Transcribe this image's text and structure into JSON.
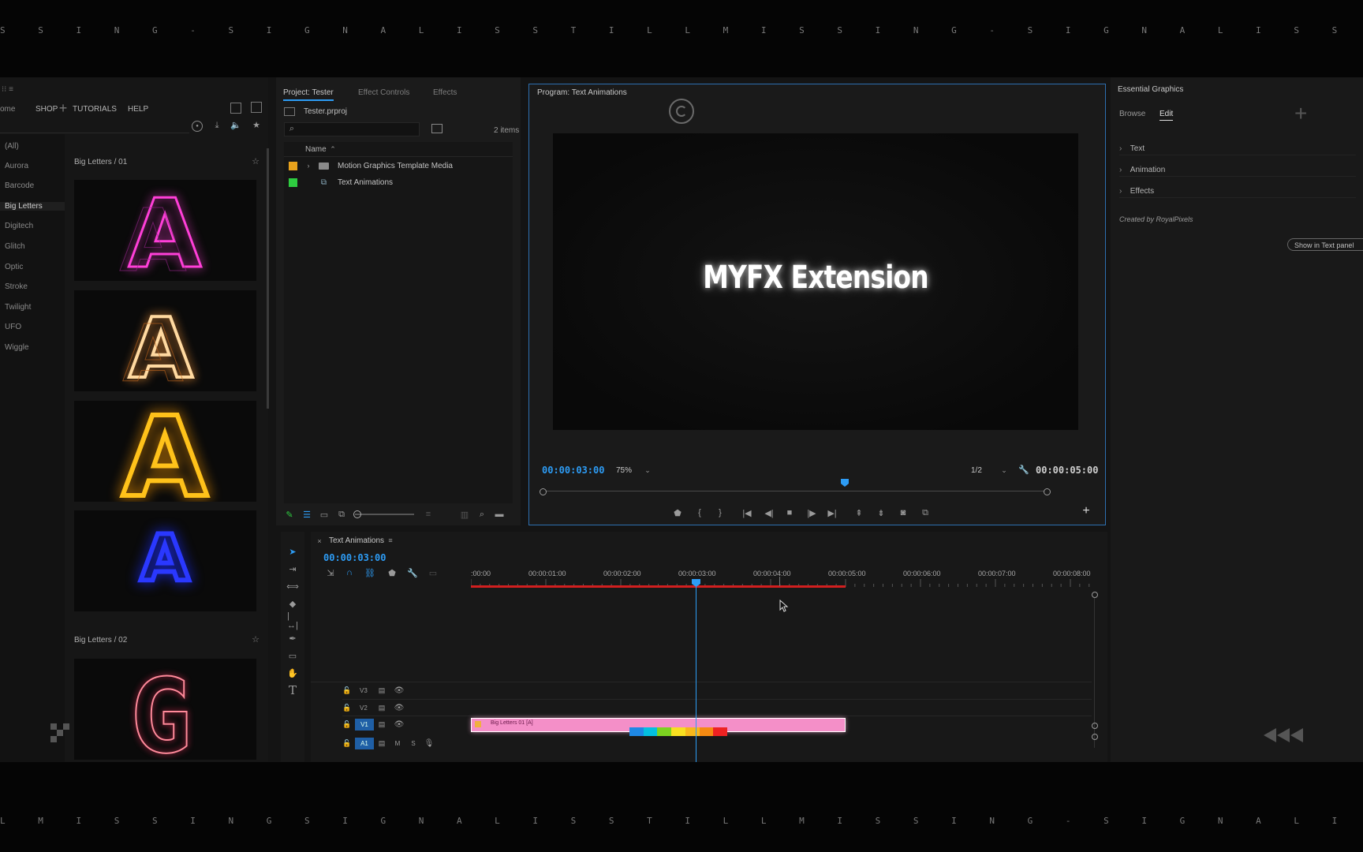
{
  "ticker": {
    "top": "S S I N G - S I G N A L I S S T I L L M I S S I N G - S I G N A L I S S T I L L M I S S I N G - S I G N A L I S S T I L L M I S S I N G S I G N A L I S",
    "bottom": "L M I S S I N G S I G N A L I S S T I L L M I S S I N G - S I G N A L I S S T I L L M I S S I N G - S I G N A L I S S T I L L M I S S I N G - S I G N A L"
  },
  "library": {
    "menu": [
      "SHOP",
      "TUTORIALS",
      "HELP"
    ],
    "partial_menu": "ome",
    "categories": [
      "(All)",
      "Aurora",
      "Barcode",
      "Big Letters",
      "Digitech",
      "Glitch",
      "Optic",
      "Stroke",
      "Twilight",
      "UFO",
      "Wiggle"
    ],
    "selected_category": "Big Letters",
    "group1_title": "Big Letters / 01",
    "group2_title": "Big Letters / 02",
    "thumbs": [
      {
        "letter": "A",
        "color": "#ff3fd8"
      },
      {
        "letter": "A",
        "color": "#ffb35a"
      },
      {
        "letter": "A",
        "color": "#ffc21a"
      },
      {
        "letter": "A",
        "color": "#2a38ff"
      },
      {
        "letter": "G",
        "color": "#ff7a8a"
      }
    ]
  },
  "project": {
    "tabs": [
      "Project: Tester",
      "Effect Controls",
      "Effects"
    ],
    "file": "Tester.prproj",
    "items_count": "2 items",
    "column_name": "Name",
    "rows": [
      {
        "label": "Motion Graphics Template Media",
        "swatch": "#e8a21c",
        "type": "folder"
      },
      {
        "label": "Text Animations",
        "swatch": "#2ecc40",
        "type": "sequence"
      }
    ]
  },
  "program": {
    "title": "Program: Text Animations",
    "video_text": "MYFX Extension",
    "current_time": "00:00:03:00",
    "zoom": "75%",
    "resolution": "1/2",
    "duration": "00:00:05:00",
    "playhead_fraction": 0.6
  },
  "essential": {
    "title": "Essential Graphics",
    "tabs": [
      "Browse",
      "Edit"
    ],
    "sections": [
      "Text",
      "Animation",
      "Effects"
    ],
    "credit": "Created by RoyalPixels",
    "button": "Show in Text panel"
  },
  "timeline": {
    "sequence": "Text Animations",
    "timecode": "00:00:03:00",
    "ruler": [
      ":00:00",
      "00:00:01:00",
      "00:00:02:00",
      "00:00:03:00",
      "00:00:04:00",
      "00:00:05:00",
      "00:00:06:00",
      "00:00:07:00",
      "00:00:08:00"
    ],
    "tracks": [
      "V3",
      "V2",
      "V1",
      "A1"
    ],
    "clip_label": "Big Letters 01 [A]",
    "clip_color": "#f48fc8",
    "in_point_seconds": 0,
    "out_point_seconds": 5,
    "playhead_seconds": 3
  },
  "colors": {
    "accent": "#2d9cf5",
    "work_area": "#d21f1f",
    "clip": "#f48fc8"
  },
  "rewind_icon": "rewind-icon"
}
